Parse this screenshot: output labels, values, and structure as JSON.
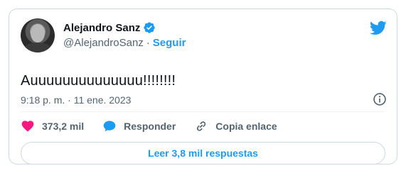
{
  "colors": {
    "accent": "#1d9bf0",
    "text": "#0f1419",
    "muted": "#536471",
    "like": "#f91880",
    "border": "#cfd9de"
  },
  "author": {
    "name": "Alejandro Sanz",
    "handle": "@AlejandroSanz",
    "separator": "·",
    "follow_label": "Seguir",
    "verified_icon": "verified-badge-icon",
    "avatar_icon": "avatar"
  },
  "brand_icon": "twitter-bird-icon",
  "tweet": {
    "text": "Auuuuuuuuuuuuuu!!!!!!!!",
    "timestamp": "9:18 p. m. · 11 ene. 2023"
  },
  "actions": {
    "like_count": "373,2 mil",
    "reply_label": "Responder",
    "copy_label": "Copia enlace"
  },
  "replies_button": "Leer 3,8 mil respuestas"
}
